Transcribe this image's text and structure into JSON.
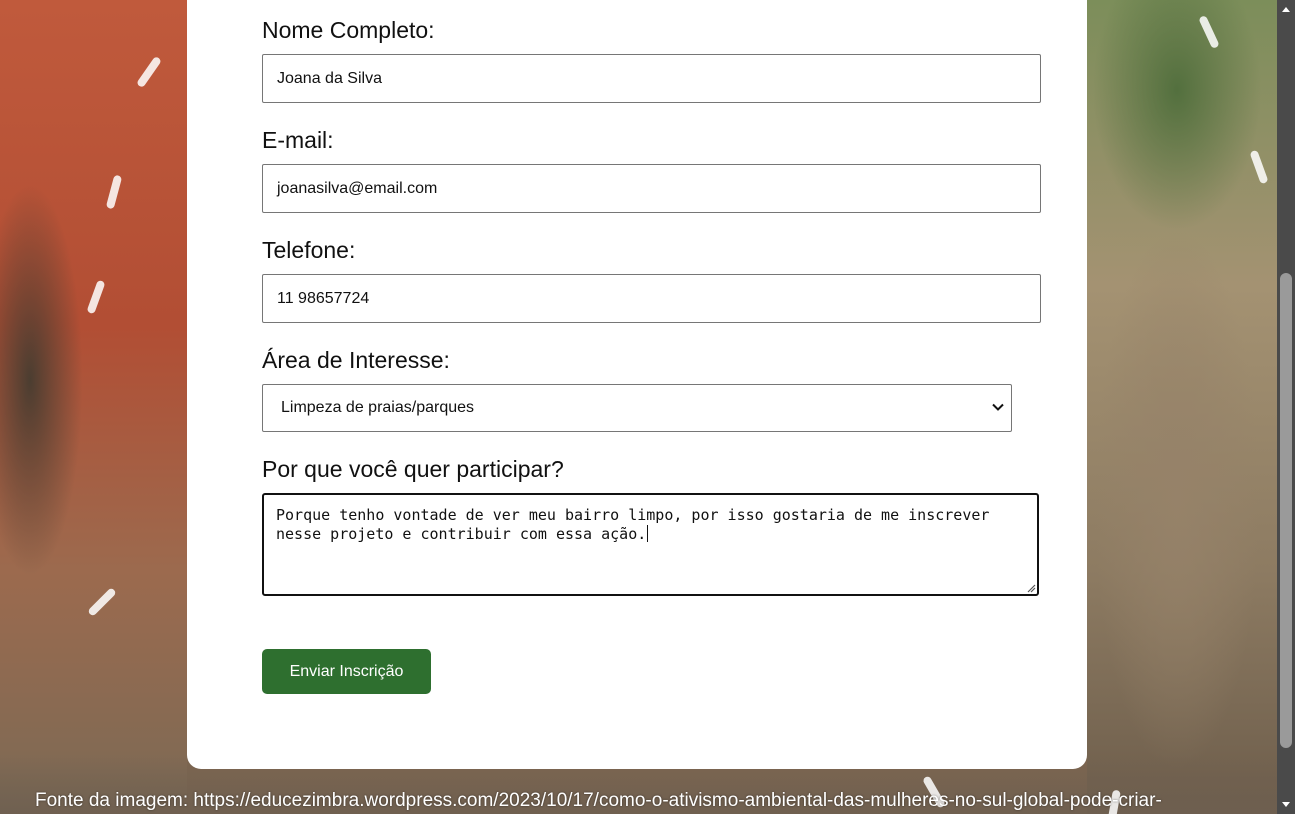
{
  "form": {
    "name_label": "Nome Completo:",
    "name_value": "Joana da Silva",
    "email_label": "E-mail:",
    "email_value": "joanasilva@email.com",
    "phone_label": "Telefone:",
    "phone_value": "11 98657724",
    "interest_label": "Área de Interesse:",
    "interest_selected": "Limpeza de praias/parques",
    "reason_label": "Por que você quer participar?",
    "reason_value": "Porque tenho vontade de ver meu bairro limpo, por isso gostaria de me inscrever\nnesse projeto e contribuir com essa ação.",
    "submit_label": "Enviar Inscrição"
  },
  "footer": {
    "credit": "Fonte da imagem: https://educezimbra.wordpress.com/2023/10/17/como-o-ativismo-ambiental-das-mulheres-no-sul-global-pode-criar-"
  },
  "colors": {
    "button_bg": "#2e6f2f",
    "card_bg": "#ffffff"
  },
  "icons": {
    "select_chevron": "chevron-down-icon",
    "scroll_up": "arrow-up-icon",
    "scroll_down": "arrow-down-icon",
    "resize_handle": "resize-grip-icon"
  }
}
